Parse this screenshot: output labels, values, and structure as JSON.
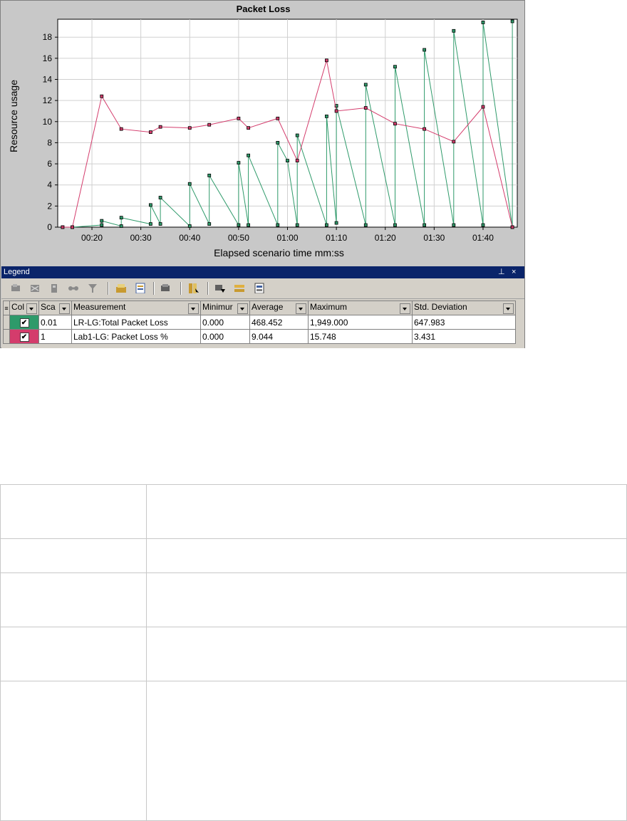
{
  "window": {
    "chart_title": "Packet Loss",
    "legend_title": "Legend",
    "legend_pin": "⊥",
    "legend_close": "×"
  },
  "chart_data": {
    "type": "line",
    "title": "Packet Loss",
    "xlabel": "Elapsed scenario time mm:ss",
    "ylabel": "Resource usage",
    "xlim": [
      13,
      107
    ],
    "ylim": [
      0,
      19.7
    ],
    "x_ticks": [
      {
        "v": 20,
        "label": "00:20"
      },
      {
        "v": 30,
        "label": "00:30"
      },
      {
        "v": 40,
        "label": "00:40"
      },
      {
        "v": 50,
        "label": "00:50"
      },
      {
        "v": 60,
        "label": "01:00"
      },
      {
        "v": 70,
        "label": "01:10"
      },
      {
        "v": 80,
        "label": "01:20"
      },
      {
        "v": 90,
        "label": "01:30"
      },
      {
        "v": 100,
        "label": "01:40"
      }
    ],
    "y_ticks": [
      0,
      2,
      4,
      6,
      8,
      10,
      12,
      14,
      16,
      18
    ],
    "grid": true,
    "series": [
      {
        "name": "LR-LG:Total Packet Loss",
        "color": "#2e9a6a",
        "points": [
          [
            14,
            0
          ],
          [
            16,
            0
          ],
          [
            22,
            0.2
          ],
          [
            22,
            0.6
          ],
          [
            26,
            0.1
          ],
          [
            26,
            0.9
          ],
          [
            32,
            0.3
          ],
          [
            32,
            2.1
          ],
          [
            34,
            0.3
          ],
          [
            34,
            2.8
          ],
          [
            40,
            0.1
          ],
          [
            40,
            4.1
          ],
          [
            44,
            0.3
          ],
          [
            44,
            4.9
          ],
          [
            50,
            0.2
          ],
          [
            50,
            6.1
          ],
          [
            52,
            0.2
          ],
          [
            52,
            6.8
          ],
          [
            58,
            0.2
          ],
          [
            58,
            8.0
          ],
          [
            60,
            6.3
          ],
          [
            62,
            0.2
          ],
          [
            62,
            8.7
          ],
          [
            68,
            0.2
          ],
          [
            68,
            10.5
          ],
          [
            70,
            0.4
          ],
          [
            70,
            11.5
          ],
          [
            76,
            0.2
          ],
          [
            76,
            13.5
          ],
          [
            82,
            0.2
          ],
          [
            82,
            15.2
          ],
          [
            88,
            0.2
          ],
          [
            88,
            16.8
          ],
          [
            94,
            0.2
          ],
          [
            94,
            18.6
          ],
          [
            100,
            0.2
          ],
          [
            100,
            19.4
          ],
          [
            106,
            0
          ],
          [
            106,
            19.5
          ]
        ]
      },
      {
        "name": "Lab1-LG: Packet Loss %",
        "color": "#d43c6c",
        "points": [
          [
            14,
            0
          ],
          [
            16,
            0
          ],
          [
            22,
            12.4
          ],
          [
            26,
            9.3
          ],
          [
            32,
            9.0
          ],
          [
            34,
            9.5
          ],
          [
            40,
            9.4
          ],
          [
            44,
            9.7
          ],
          [
            50,
            10.3
          ],
          [
            52,
            9.4
          ],
          [
            58,
            10.3
          ],
          [
            62,
            6.3
          ],
          [
            68,
            15.8
          ],
          [
            70,
            11.0
          ],
          [
            76,
            11.3
          ],
          [
            82,
            9.8
          ],
          [
            88,
            9.3
          ],
          [
            94,
            8.1
          ],
          [
            100,
            11.4
          ],
          [
            106,
            0
          ]
        ]
      }
    ]
  },
  "legend": {
    "headers": [
      "Col",
      "Sca",
      "Measurement",
      "Minimur",
      "Average",
      "Maximum",
      "Std. Deviation"
    ],
    "rows": [
      {
        "color": "#2e9a6a",
        "scale": "0.01",
        "measurement": "LR-LG:Total Packet Loss",
        "min": "0.000",
        "avg": "468.452",
        "max": "1,949.000",
        "std": "647.983"
      },
      {
        "color": "#d43c6c",
        "scale": "1",
        "measurement": "Lab1-LG: Packet Loss %",
        "min": "0.000",
        "avg": "9.044",
        "max": "15.748",
        "std": "3.431"
      }
    ],
    "check_mark": "✔"
  }
}
